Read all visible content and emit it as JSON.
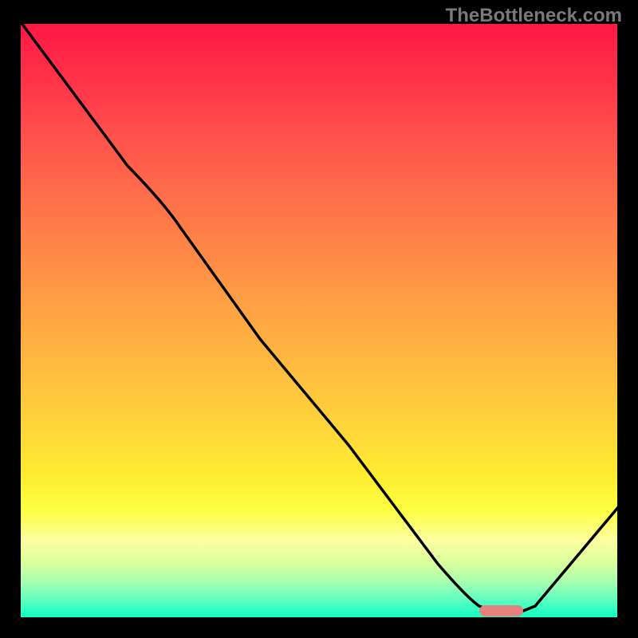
{
  "watermark": "TheBottleneck.com",
  "colors": {
    "background": "#000000",
    "curve": "#000000",
    "marker": "#e88080"
  },
  "chart_data": {
    "type": "line",
    "title": "",
    "xlabel": "",
    "ylabel": "",
    "xlim": [
      0,
      100
    ],
    "ylim": [
      0,
      100
    ],
    "grid": false,
    "legend": false,
    "series": [
      {
        "name": "bottleneck-curve",
        "x": [
          0,
          18,
          26,
          40,
          55,
          70,
          76,
          82,
          86,
          100
        ],
        "y": [
          100,
          76,
          70,
          50,
          29,
          9,
          2,
          0.5,
          1,
          18
        ],
        "note": "Estimated by reading normalized positions off the plot; single black curve dipping to a minimum near x≈80"
      }
    ],
    "marker": {
      "x_center": 80,
      "y": 0.5,
      "width_pct": 6,
      "note": "Rounded pink segment highlighting the minimum region of the curve"
    },
    "background_gradient_desc": "Vertical gradient from hot pink/red at top through orange, yellow, to green-cyan at bottom"
  }
}
